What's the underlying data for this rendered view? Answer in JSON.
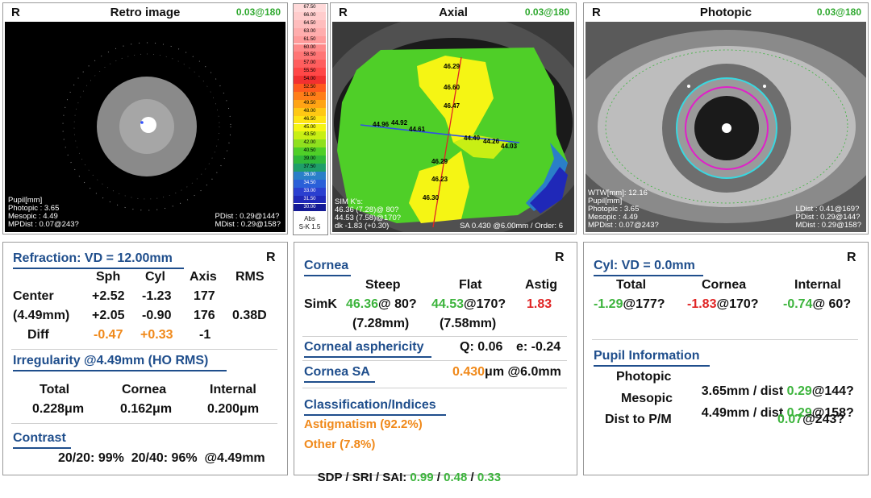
{
  "retro": {
    "eye": "R",
    "title": "Retro image",
    "meas": "0.03@180",
    "left_lines": [
      "Pupil[mm]",
      "Photopic : 3.65",
      "Mesopic : 4.49",
      "MPDist : 0.07@243?"
    ],
    "right_lines": [
      "PDist : 0.29@144?",
      "MDist : 0.29@158?"
    ]
  },
  "scale": {
    "values": [
      "67.50",
      "66.00",
      "64.50",
      "63.00",
      "61.50",
      "60.00",
      "58.50",
      "57.00",
      "55.50",
      "54.00",
      "52.50",
      "51.00",
      "49.50",
      "48.00",
      "46.50",
      "45.00",
      "43.50",
      "42.00",
      "40.50",
      "39.00",
      "37.50",
      "36.00",
      "34.50",
      "33.00",
      "31.50",
      "30.00"
    ],
    "colors": [
      "#ffd9d9",
      "#ffcccc",
      "#ffbdbd",
      "#ffadad",
      "#ff9c9c",
      "#ff8a8a",
      "#ff7575",
      "#ff5e5e",
      "#ff4747",
      "#f23030",
      "#ff5a1e",
      "#ff7e18",
      "#ffa414",
      "#ffc814",
      "#ffe414",
      "#f5f514",
      "#c8ef14",
      "#8fe01e",
      "#4fcf28",
      "#2fb83a",
      "#1f9e6a",
      "#2a7fc8",
      "#2a5fd8",
      "#2a3fd0",
      "#1f28b8",
      "#141a96"
    ],
    "footer1": "Abs",
    "footer2": "S-K 1.5"
  },
  "axial": {
    "eye": "R",
    "title": "Axial",
    "meas": "0.03@180",
    "values": [
      "46.29",
      "46.60",
      "46.47",
      "44.96",
      "44.92",
      "44.61",
      "44.40",
      "44.26",
      "44.03",
      "46.29",
      "46.23",
      "46.30"
    ],
    "simk_lines": [
      "SIM K's:",
      "46.36 (7.28)@ 80?",
      "44.53 (7.58)@170?",
      "dk -1.83 (+0.30)"
    ],
    "bottom_right": "SA  0.430 @6.00mm / Order: 6"
  },
  "photopic": {
    "eye": "R",
    "title": "Photopic",
    "meas": "0.03@180",
    "left_lines": [
      "WTW[mm]: 12.16",
      "Pupil[mm]",
      "Photopic : 3.65",
      "Mesopic : 4.49",
      "MPDist : 0.07@243?"
    ],
    "right_lines": [
      "LDist : 0.41@169?",
      "PDist : 0.29@144?",
      "MDist : 0.29@158?"
    ]
  },
  "refraction": {
    "title": "Refraction: VD = 12.00mm",
    "eye": "R",
    "headers": [
      "Sph",
      "Cyl",
      "Axis",
      "RMS"
    ],
    "rows": [
      {
        "label": "Center",
        "sph": "+2.52",
        "cyl": "-1.23",
        "axis": "177",
        "rms": ""
      },
      {
        "label": "(4.49mm)",
        "sph": "+2.05",
        "cyl": "-0.90",
        "axis": "176",
        "rms": "0.38D"
      },
      {
        "label": "Diff",
        "sph": "-0.47",
        "cyl": "+0.33",
        "axis": "-1",
        "rms": ""
      }
    ],
    "irregularity_title": "Irregularity @4.49mm (HO RMS)",
    "irr_headers": [
      "Total",
      "Cornea",
      "Internal"
    ],
    "irr_values": [
      "0.228μm",
      "0.162μm",
      "0.200μm"
    ],
    "contrast_title": "Contrast",
    "contrast_line": "20/20: 99%  20/40: 96%  @4.49mm"
  },
  "cornea": {
    "title": "Cornea",
    "eye": "R",
    "headers": [
      "Steep",
      "Flat",
      "Astig"
    ],
    "simk_label": "SimK",
    "steep_val": "46.36",
    "steep_axis": "@ 80?",
    "flat_val": "44.53",
    "flat_axis": "@170?",
    "astig_val": "1.83",
    "steep_mm": "(7.28mm)",
    "flat_mm": "(7.58mm)",
    "asph_title": "Corneal asphericity",
    "q_value": "Q: 0.06",
    "e_value": "e: -0.24",
    "sa_title": "Cornea SA",
    "sa_value": "0.430",
    "sa_unit": "μm @6.0mm",
    "class_title": "Classification/Indices",
    "class1": "Astigmatism (92.2%)",
    "class2": "Other (7.8%)",
    "sdp_label": "SDP / SRI / SAI: ",
    "sdp": "0.99",
    "sri": "0.48",
    "sai": "0.33",
    "slash": " / "
  },
  "cyl": {
    "title": "Cyl: VD = 0.0mm",
    "eye": "R",
    "headers": [
      "Total",
      "Cornea",
      "Internal"
    ],
    "total_val": "-1.29",
    "total_axis": "@177?",
    "cornea_val": "-1.83",
    "cornea_axis": "@170?",
    "internal_val": "-0.74",
    "internal_axis": "@ 60?",
    "pupil_title": "Pupil Information",
    "photopic_label": "Photopic",
    "photopic_text": "3.65mm / dist ",
    "photopic_val": "0.29",
    "photopic_axis": "@144?",
    "mesopic_label": "Mesopic",
    "mesopic_text": "4.49mm / dist ",
    "mesopic_val": "0.29",
    "mesopic_axis": "@158?",
    "dist_label": "Dist to P/M",
    "dist_val": "0.07",
    "dist_axis": "@243?"
  }
}
